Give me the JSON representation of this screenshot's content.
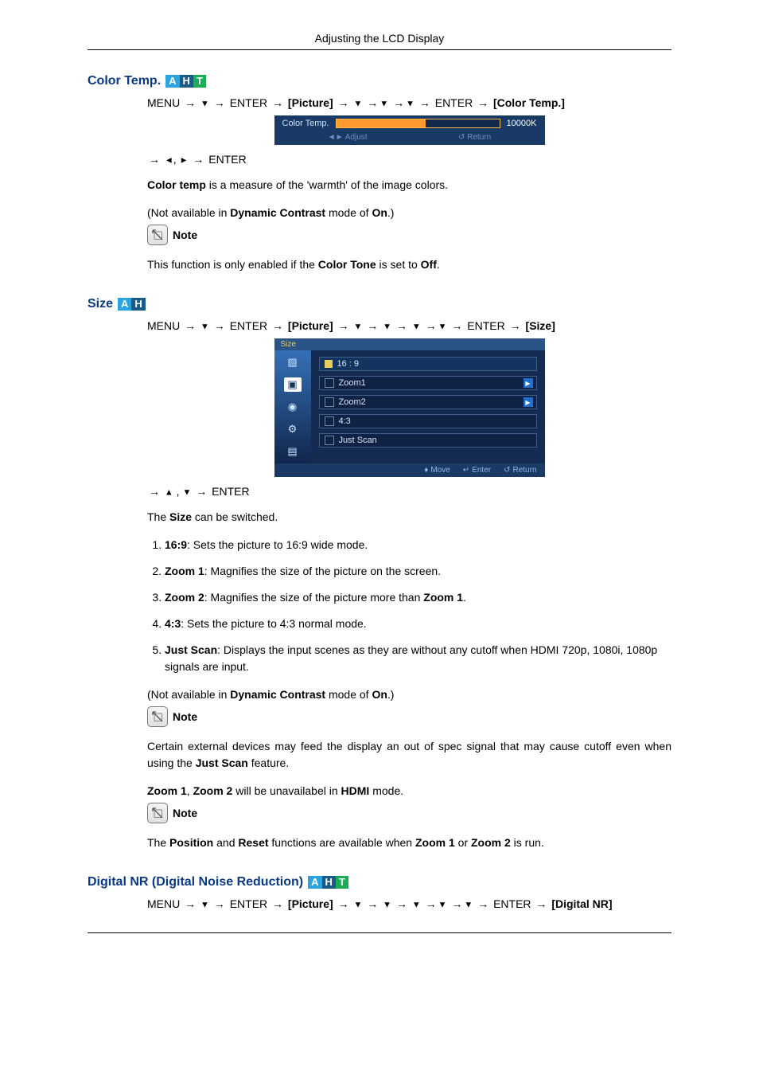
{
  "header": {
    "title": "Adjusting the LCD Display"
  },
  "badges": {
    "a": "A",
    "h": "H",
    "t": "T"
  },
  "arrows": {
    "right": "→",
    "down_tri": "▼",
    "up_tri": "▲",
    "left_tri": "◄",
    "right_tri": "►"
  },
  "common": {
    "menu": "MENU",
    "enter": "ENTER",
    "picture_label": "[Picture]",
    "note_label": "Note",
    "dyn_contrast_line_prefix": "(Not available in ",
    "dyn_contrast_bold": "Dynamic Contrast",
    "dyn_contrast_line_mid": " mode of ",
    "dyn_contrast_on": "On",
    "dyn_contrast_line_suffix": ".)"
  },
  "colorTemp": {
    "heading": "Color Temp.",
    "bracket_label": "[Color Temp.]",
    "afterNav": "ENTER",
    "osd": {
      "label": "Color Temp.",
      "value": "10000K",
      "adjust": "Adjust",
      "return": "Return"
    },
    "desc_prefix": "Color temp",
    "desc_rest": " is a measure of the 'warmth' of the image colors.",
    "note_line_prefix": "This function is only enabled if the ",
    "note_bold1": "Color Tone",
    "note_mid": " is set to ",
    "note_bold2": "Off",
    "note_suffix": "."
  },
  "size": {
    "heading": "Size",
    "bracket_label": "[Size]",
    "osd": {
      "title": "Size",
      "opts": [
        "16 : 9",
        "Zoom1",
        "Zoom2",
        "4:3",
        "Just Scan"
      ],
      "move": "Move",
      "enter": "Enter",
      "return": "Return"
    },
    "afterNav": "ENTER",
    "switch_line_prefix": "The ",
    "switch_line_bold": "Size",
    "switch_line_suffix": " can be switched.",
    "items": [
      {
        "bold": "16:9",
        "rest": ": Sets the picture to 16:9 wide mode."
      },
      {
        "bold": "Zoom 1",
        "rest": ": Magnifies the size of the picture on the screen."
      },
      {
        "bold": "Zoom 2",
        "rest_pre": ": Magnifies the size of the picture more than ",
        "rest_bold": "Zoom 1",
        "rest_post": "."
      },
      {
        "bold": "4:3",
        "rest": ": Sets the picture to 4:3 normal mode."
      },
      {
        "bold": "Just Scan",
        "rest": ": Displays the input scenes as they are without any cutoff when HDMI 720p, 1080i, 1080p signals are input."
      }
    ],
    "note1_prefix": "Certain external devices may feed the display an out of spec signal that may cause cutoff even when using the ",
    "note1_bold": "Just Scan",
    "note1_suffix": " feature.",
    "zoom_line_b1": "Zoom 1",
    "zoom_line_sep": ", ",
    "zoom_line_b2": "Zoom 2",
    "zoom_line_mid": " will be unavailabel in ",
    "zoom_line_b3": "HDMI",
    "zoom_line_suffix": " mode.",
    "note2_prefix": "The ",
    "note2_b1": "Position",
    "note2_mid1": " and ",
    "note2_b2": "Reset",
    "note2_mid2": " functions are available when  ",
    "note2_b3": "Zoom 1",
    "note2_mid3": " or  ",
    "note2_b4": "Zoom 2",
    "note2_suffix": " is run."
  },
  "digitalNR": {
    "heading": "Digital NR (Digital Noise Reduction)",
    "bracket_label": "[Digital NR]"
  }
}
